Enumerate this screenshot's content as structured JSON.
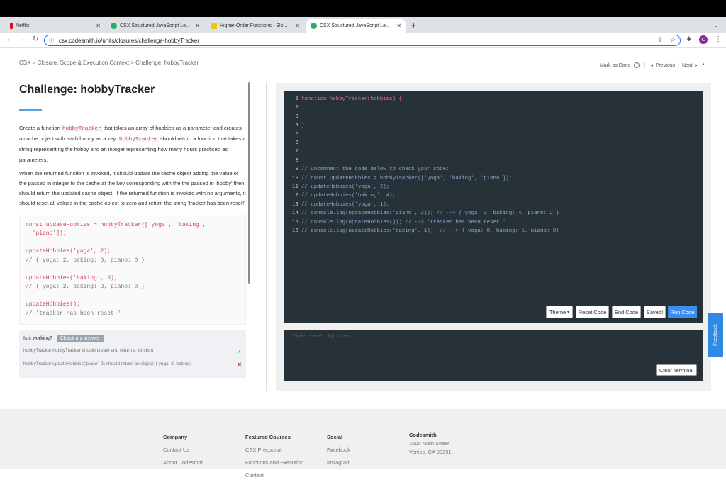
{
  "browser": {
    "tabs": [
      {
        "label": "Netflix",
        "color": "#e50914",
        "active": false
      },
      {
        "label": "CSX Structured JavaScript Le...",
        "color": "#27ae60",
        "active": false
      },
      {
        "label": "Higher-Order Functions - Elo...",
        "color": "#f1c40f",
        "active": false
      },
      {
        "label": "CSX Structured JavaScript Le...",
        "color": "#27ae60",
        "active": true
      }
    ],
    "url": "csx.codesmith.io/units/closures/challenge-hobbyTracker",
    "profile_initial": "C"
  },
  "breadcrumb": "CSX > Closure, Scope & Execution Context > Challenge: hobbyTracker",
  "mark_done": "Mark as Done",
  "nav": {
    "previous": "Previous",
    "next": "Next"
  },
  "challenge": {
    "title": "Challenge: hobbyTracker",
    "p1_a": "Create a function ",
    "p1_code": "hobbyTracker",
    "p1_b": " that takes an array of hobbies as a parameter and creates a cache object with each hobby as a key. ",
    "p1_code2": "hobbyTracker",
    "p1_c": " should return a function that takes a string representing the hobby and an integer representing how many hours practiced as parameters.",
    "p2": "When the returned function is invoked, it should update the cache object adding the value of the passed in integer to the cache at the key corresponding with the the passed in 'hobby' then should return the updated cache object. If the returned function is invoked with no arguments, it should reset all values in the cache object to zero and return the string 'tracker has been reset!'"
  },
  "example": [
    "const updateHobbies = hobbyTracker(['yoga', 'baking',",
    "  'piano']);",
    "",
    "updateHobbies('yoga', 2);",
    "// { yoga: 2, baking: 0, piano: 0 }",
    "",
    "updateHobbies('baking', 3);",
    "// { yoga: 2, baking: 3, piano: 0 }",
    "",
    "updateHobbies();",
    "// 'tracker has been reset!'"
  ],
  "working": {
    "label": "Is it working?",
    "check_button": "Check my answer",
    "tests": [
      {
        "text": "hobbyTracker hobbyTracker should create and return a function",
        "pass": true,
        "mark": "✓"
      },
      {
        "text": "hobbyTracker updateHobbies('piano', 2) should return an object: { yoga: 3, baking:",
        "pass": false,
        "mark": "✖"
      }
    ]
  },
  "editor": {
    "lines": [
      "function hobbyTracker(hobbies) {",
      "",
      "",
      "}",
      "",
      "",
      "",
      "",
      "// Uncomment the code below to check your code:",
      "// const updateHobbies = hobbyTracker(['yoga', 'baking', 'piano']);",
      "// updateHobbies('yoga', 2);",
      "// updateHobbies('baking', 4);",
      "// updateHobbies('yoga', 1);",
      "// console.log(updateHobbies('piano', 2)); // --> { yoga: 3, baking: 4, piano: 2 }",
      "// console.log(updateHobbies()); // --> 'tracker has been reset!'",
      "// console.log(updateHobbies('baking', 1)); // --> { yoga: 0, baking: 1, piano: 0}"
    ],
    "buttons": {
      "theme": "Theme",
      "reset": "Reset Code",
      "end": "End Code",
      "saved": "Saved!",
      "run": "Run Code"
    }
  },
  "terminal": {
    "text": "Code reset by user.",
    "clear": "Clear Terminal"
  },
  "feedback": "Feedback",
  "footer": {
    "company": {
      "head": "Company",
      "items": [
        "Contact Us",
        "About Codesmith"
      ]
    },
    "courses": {
      "head": "Featured Courses",
      "items": [
        "CSX Precourse",
        "Functions and Execution",
        "Context"
      ]
    },
    "social": {
      "head": "Social",
      "items": [
        "Facebook",
        "Instagram"
      ]
    },
    "codesmith": {
      "head": "Codesmith",
      "items": [
        "1600 Main Street",
        "Venice, CA 90291"
      ]
    }
  }
}
